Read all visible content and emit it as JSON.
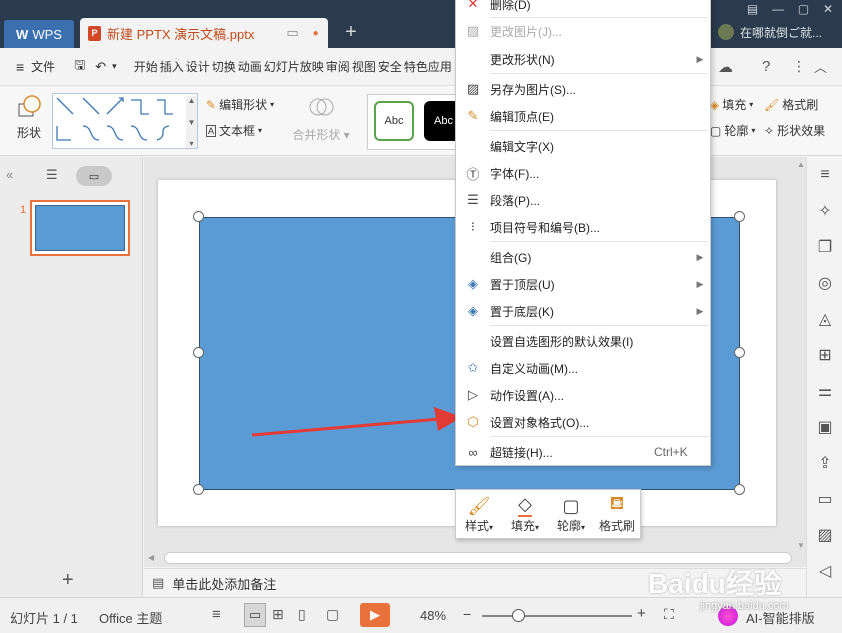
{
  "titlebar": {
    "wps_label": "WPS",
    "doc_tab": "新建 PPTX 演示文稿.pptx",
    "doc_icon_letter": "P",
    "new_tab": "+",
    "user_hint": "在哪就倒ご就..."
  },
  "menubar": {
    "file": "文件",
    "items": [
      "开始",
      "插入",
      "设计",
      "切换",
      "动画",
      "幻灯片放映",
      "审阅",
      "视图",
      "安全",
      "特色应用"
    ],
    "help": "?"
  },
  "ribbon": {
    "shape_label": "形状",
    "edit_shape": "编辑形状",
    "textbox": "文本框",
    "merge_shape": "合并形状",
    "style1": "Abc",
    "style2": "Abc",
    "fill": "填充",
    "format_brush": "格式刷",
    "outline": "轮廓",
    "shape_effect": "形状效果"
  },
  "leftpanel": {
    "slide_number": "1"
  },
  "context_menu": {
    "items": [
      {
        "label": "删除(D)",
        "icon": "delete-icon",
        "disabled": false
      },
      {
        "label": "更改图片(J)...",
        "icon": "image-icon",
        "disabled": true
      },
      {
        "label": "更改形状(N)",
        "icon": "",
        "submenu": true
      },
      {
        "label": "另存为图片(S)...",
        "icon": "save-image-icon"
      },
      {
        "label": "编辑顶点(E)",
        "icon": "edit-points-icon"
      },
      {
        "label": "编辑文字(X)",
        "icon": ""
      },
      {
        "label": "字体(F)...",
        "icon": "font-icon"
      },
      {
        "label": "段落(P)...",
        "icon": "paragraph-icon"
      },
      {
        "label": "项目符号和编号(B)...",
        "icon": "bullets-icon"
      },
      {
        "label": "组合(G)",
        "icon": "",
        "submenu": true
      },
      {
        "label": "置于顶层(U)",
        "icon": "bring-front-icon",
        "submenu": true
      },
      {
        "label": "置于底层(K)",
        "icon": "send-back-icon",
        "submenu": true
      },
      {
        "label": "设置自选图形的默认效果(I)",
        "icon": ""
      },
      {
        "label": "自定义动画(M)...",
        "icon": "animation-icon"
      },
      {
        "label": "动作设置(A)...",
        "icon": "action-icon"
      },
      {
        "label": "设置对象格式(O)...",
        "icon": "format-object-icon"
      },
      {
        "label": "超链接(H)...",
        "icon": "hyperlink-icon",
        "shortcut": "Ctrl+K"
      }
    ]
  },
  "mini_toolbar": {
    "style": "样式",
    "fill": "填充",
    "outline": "轮廓",
    "format_brush": "格式刷"
  },
  "notes": {
    "placeholder": "单击此处添加备注"
  },
  "statusbar": {
    "slide_info": "幻灯片 1 / 1",
    "theme": "Office 主题",
    "zoom": "48%",
    "ai_label": "AI-智能排版"
  },
  "watermark": {
    "text": "Baidu经验",
    "url": "jingyan.baidu.com"
  },
  "colors": {
    "title_bg": "#2b3a4c",
    "shape_fill": "#5b9bd5",
    "accent_orange": "#e8713c",
    "arrow_red": "#e23a35"
  }
}
